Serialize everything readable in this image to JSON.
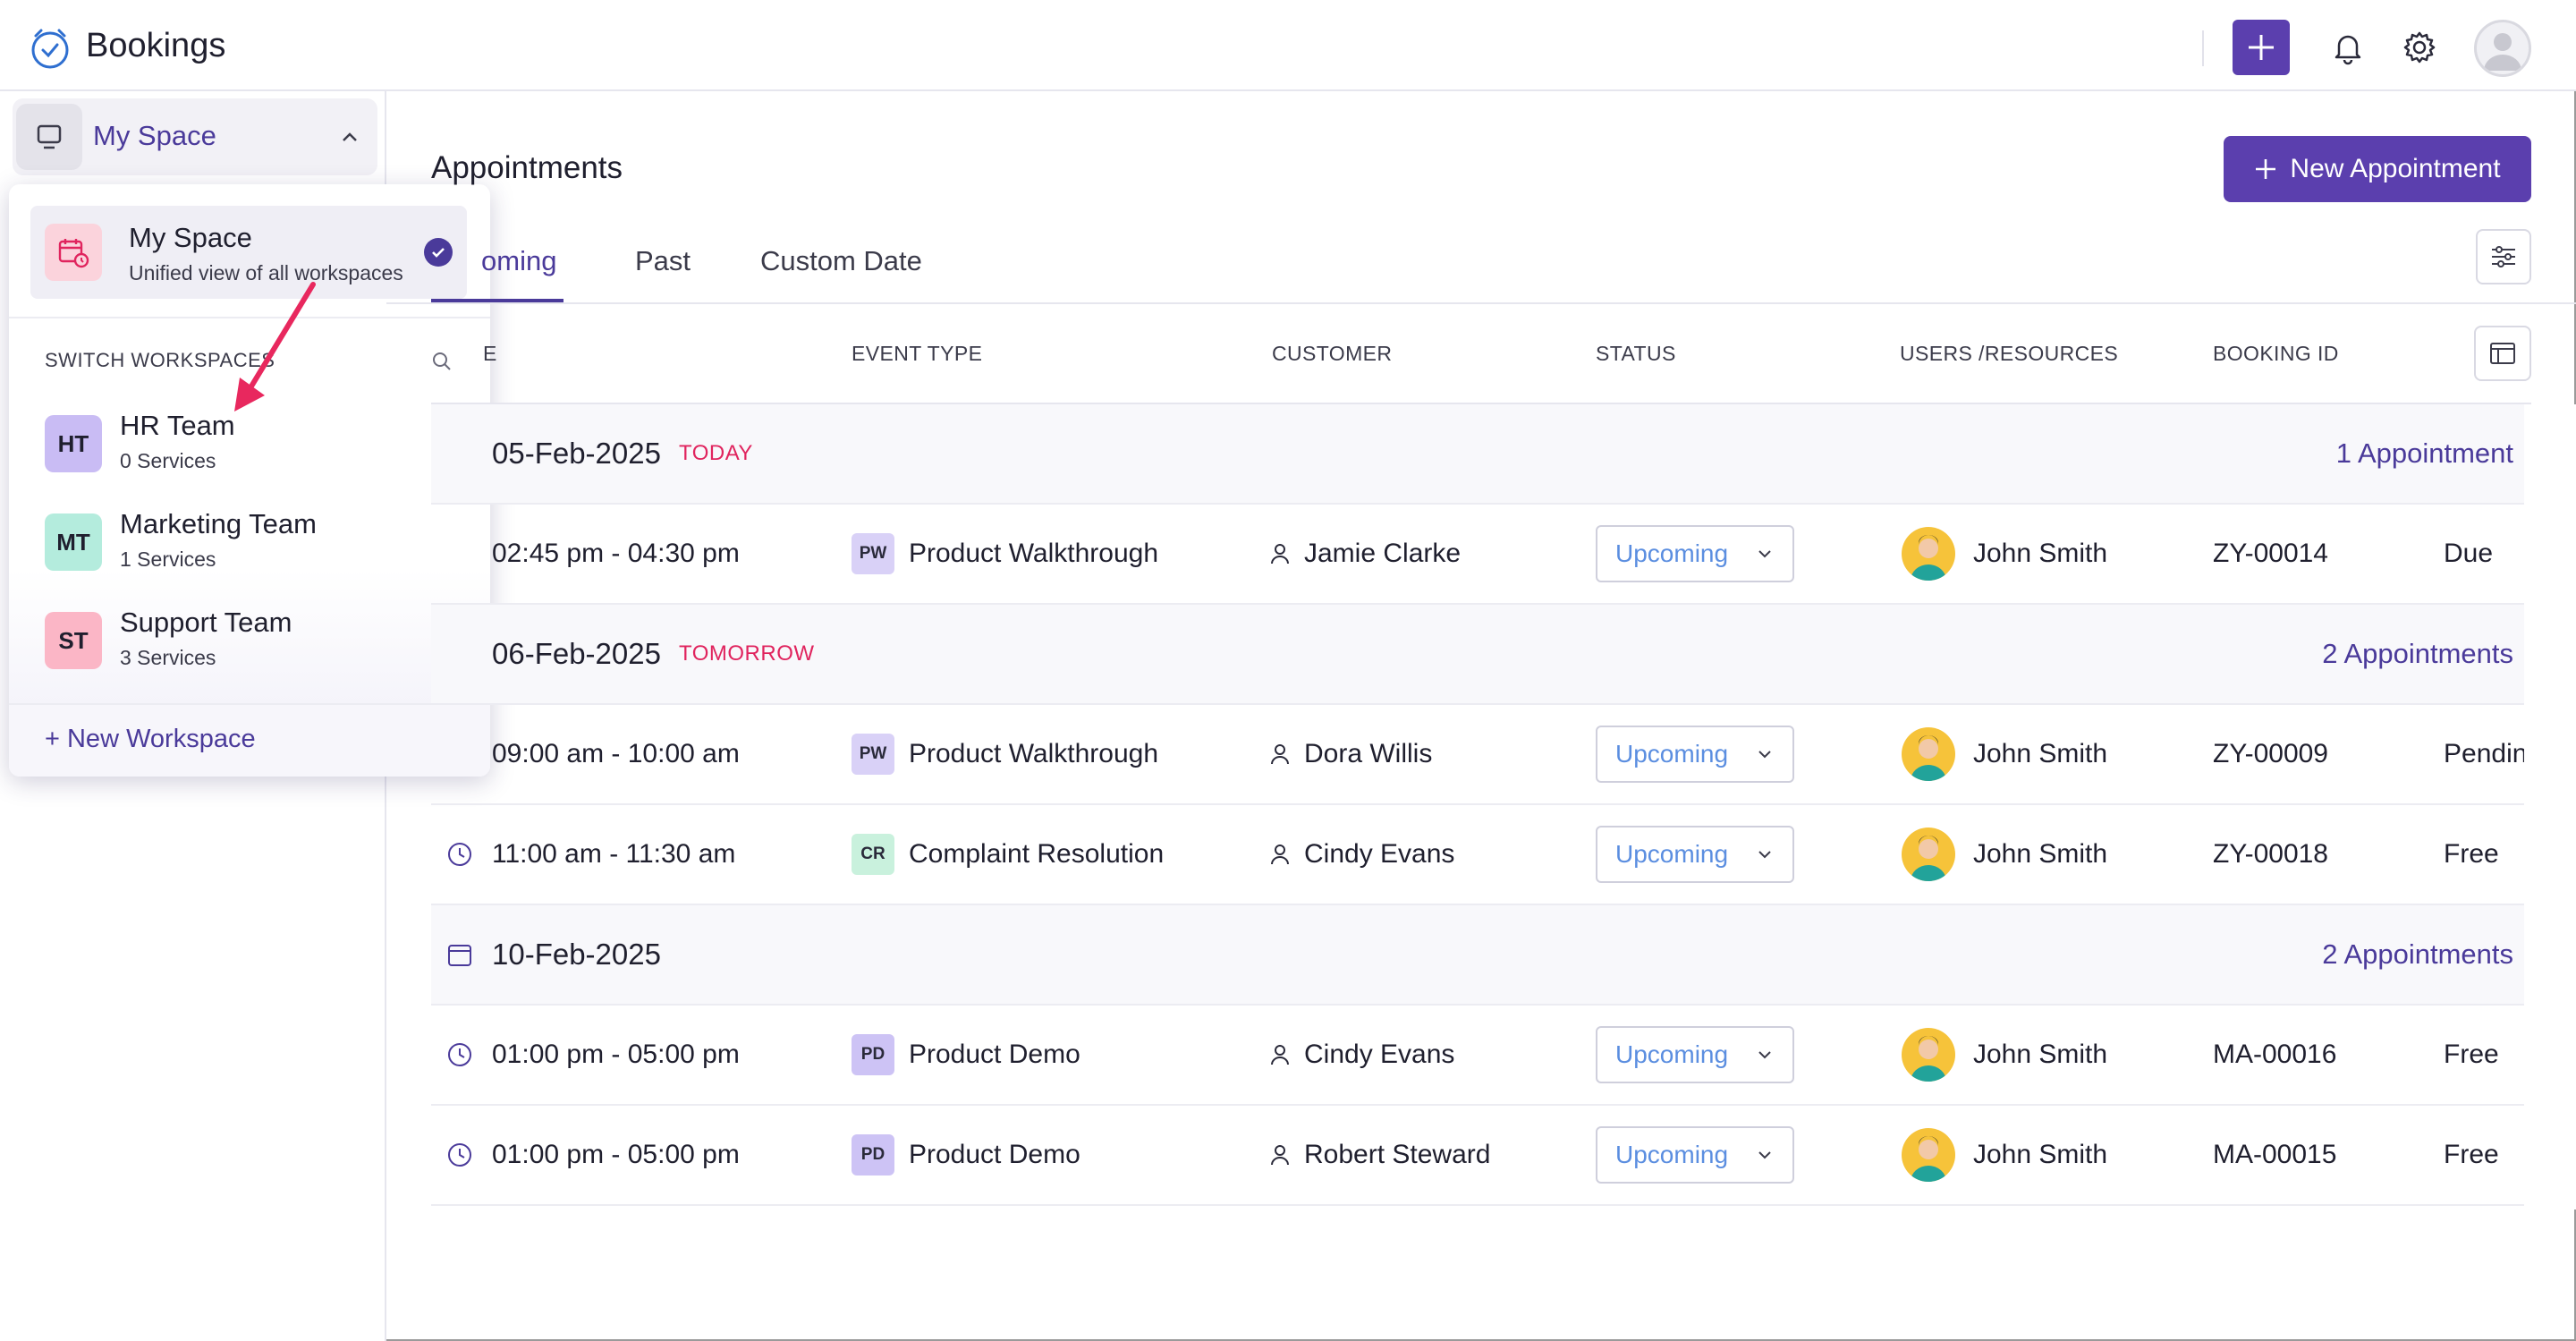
{
  "app": {
    "title": "Bookings"
  },
  "sidebar": {
    "current_space": "My Space",
    "popup": {
      "selected": {
        "title": "My Space",
        "subtitle": "Unified view of all workspaces"
      },
      "switch_label": "SWITCH WORKSPACES",
      "workspaces": [
        {
          "initials": "HT",
          "name": "HR Team",
          "services": "0 Services",
          "color": "#c9bcf4"
        },
        {
          "initials": "MT",
          "name": "Marketing Team",
          "services": "1 Services",
          "color": "#b4ecdd"
        },
        {
          "initials": "ST",
          "name": "Support Team",
          "services": "3 Services",
          "color": "#fbb6c6"
        }
      ],
      "new_workspace": "+ New Workspace"
    }
  },
  "main": {
    "title": "Appointments",
    "new_button": "New Appointment",
    "tabs": [
      {
        "label": "oming",
        "active": true
      },
      {
        "label": "Past",
        "active": false
      },
      {
        "label": "Custom Date",
        "active": false
      }
    ],
    "columns": [
      "E",
      "EVENT TYPE",
      "CUSTOMER",
      "STATUS",
      "USERS /RESOURCES",
      "BOOKING ID"
    ],
    "groups": [
      {
        "date": "05-Feb-2025",
        "tag": "TODAY",
        "count": "1 Appointment",
        "rows": [
          {
            "time": "02:45 pm - 04:30 pm",
            "event_badge": "PW",
            "event": "Product Walkthrough",
            "customer": "Jamie Clarke",
            "status": "Upcoming",
            "user": "John Smith",
            "booking_id": "ZY-00014",
            "payment": "Due"
          }
        ]
      },
      {
        "date": "06-Feb-2025",
        "tag": "TOMORROW",
        "count": "2 Appointments",
        "rows": [
          {
            "time": "09:00 am - 10:00 am",
            "event_badge": "PW",
            "event": "Product Walkthrough",
            "customer": "Dora Willis",
            "status": "Upcoming",
            "user": "John Smith",
            "booking_id": "ZY-00009",
            "payment": "Pending"
          },
          {
            "time": "11:00 am - 11:30 am",
            "event_badge": "CR",
            "event": "Complaint Resolution",
            "customer": "Cindy Evans",
            "status": "Upcoming",
            "user": "John Smith",
            "booking_id": "ZY-00018",
            "payment": "Free"
          }
        ]
      },
      {
        "date": "10-Feb-2025",
        "tag": "",
        "count": "2 Appointments",
        "rows": [
          {
            "time": "01:00 pm - 05:00 pm",
            "event_badge": "PD",
            "event": "Product Demo",
            "customer": "Cindy Evans",
            "status": "Upcoming",
            "user": "John Smith",
            "booking_id": "MA-00016",
            "payment": "Free"
          },
          {
            "time": "01:00 pm - 05:00 pm",
            "event_badge": "PD",
            "event": "Product Demo",
            "customer": "Robert Steward",
            "status": "Upcoming",
            "user": "John Smith",
            "booking_id": "MA-00015",
            "payment": "Free"
          }
        ]
      }
    ]
  },
  "colors": {
    "accent": "#5b3fae",
    "accent_text": "#4a3a9a",
    "today_tag": "#e0245e",
    "status_text": "#5b8ee0",
    "badge_pw": "#d9d1f7",
    "badge_cr": "#c9f1dd",
    "badge_pd": "#cdc3f5"
  },
  "icons": {
    "logo": "clock-calendar-icon",
    "plus": "plus-icon",
    "bell": "bell-icon",
    "gear": "gear-icon",
    "avatar": "user-avatar-icon",
    "space": "monitor-icon",
    "chevron": "chevron-up-icon",
    "check": "check-circle-icon",
    "search": "search-icon",
    "filter": "sliders-icon",
    "columns": "columns-icon",
    "clock": "clock-icon",
    "calendar": "calendar-icon",
    "person": "person-icon"
  }
}
